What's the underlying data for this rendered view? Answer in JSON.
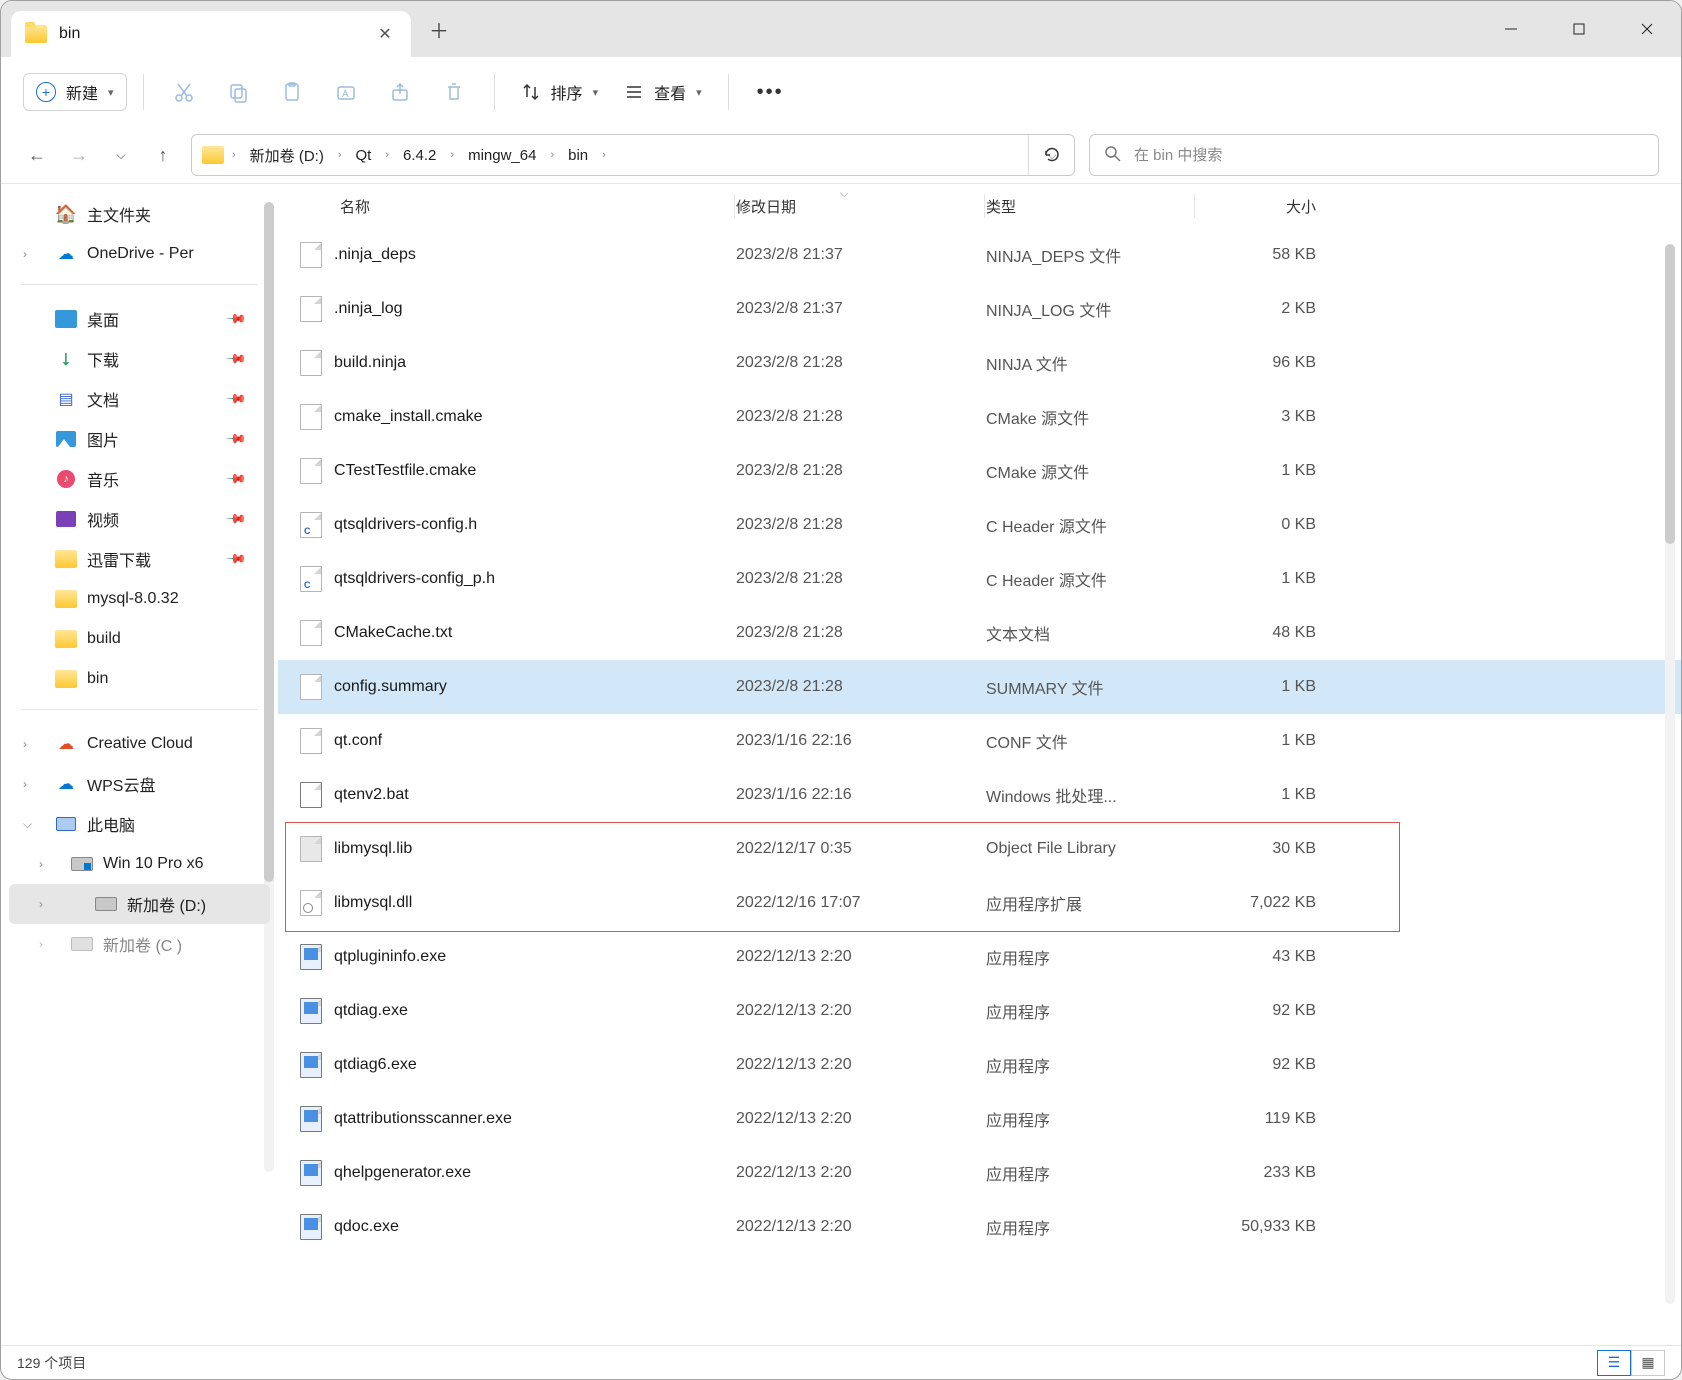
{
  "tab": {
    "title": "bin"
  },
  "toolbar": {
    "new_label": "新建",
    "sort_label": "排序",
    "view_label": "查看"
  },
  "navbar": {
    "search_placeholder": "在 bin 中搜索"
  },
  "breadcrumb": {
    "items": [
      "新加卷 (D:)",
      "Qt",
      "6.4.2",
      "mingw_64",
      "bin"
    ]
  },
  "columns": {
    "name": "名称",
    "date": "修改日期",
    "type": "类型",
    "size": "大小"
  },
  "sidebar": {
    "home": "主文件夹",
    "onedrive": "OneDrive - Per",
    "quick": {
      "desktop": "桌面",
      "downloads": "下载",
      "documents": "文档",
      "pictures": "图片",
      "music": "音乐",
      "videos": "视频",
      "xunlei": "迅雷下载",
      "mysql": "mysql-8.0.32",
      "build": "build",
      "bin": "bin"
    },
    "cc": "Creative Cloud",
    "wps": "WPS云盘",
    "thispc": "此电脑",
    "drive_c": "Win 10 Pro x6",
    "drive_d": "新加卷 (D:)",
    "drive_extra": "新加卷 (C )"
  },
  "files": [
    {
      "name": ".ninja_deps",
      "date": "2023/2/8 21:37",
      "type": "NINJA_DEPS 文件",
      "size": "58 KB",
      "ic": "plain"
    },
    {
      "name": ".ninja_log",
      "date": "2023/2/8 21:37",
      "type": "NINJA_LOG 文件",
      "size": "2 KB",
      "ic": "plain"
    },
    {
      "name": "build.ninja",
      "date": "2023/2/8 21:28",
      "type": "NINJA 文件",
      "size": "96 KB",
      "ic": "plain"
    },
    {
      "name": "cmake_install.cmake",
      "date": "2023/2/8 21:28",
      "type": "CMake 源文件",
      "size": "3 KB",
      "ic": "plain"
    },
    {
      "name": "CTestTestfile.cmake",
      "date": "2023/2/8 21:28",
      "type": "CMake 源文件",
      "size": "1 KB",
      "ic": "plain"
    },
    {
      "name": "qtsqldrivers-config.h",
      "date": "2023/2/8 21:28",
      "type": "C Header 源文件",
      "size": "0 KB",
      "ic": "c"
    },
    {
      "name": "qtsqldrivers-config_p.h",
      "date": "2023/2/8 21:28",
      "type": "C Header 源文件",
      "size": "1 KB",
      "ic": "c"
    },
    {
      "name": "CMakeCache.txt",
      "date": "2023/2/8 21:28",
      "type": "文本文档",
      "size": "48 KB",
      "ic": "plain"
    },
    {
      "name": "config.summary",
      "date": "2023/2/8 21:28",
      "type": "SUMMARY 文件",
      "size": "1 KB",
      "ic": "plain",
      "selected": true
    },
    {
      "name": "qt.conf",
      "date": "2023/1/16 22:16",
      "type": "CONF 文件",
      "size": "1 KB",
      "ic": "plain"
    },
    {
      "name": "qtenv2.bat",
      "date": "2023/1/16 22:16",
      "type": "Windows 批处理...",
      "size": "1 KB",
      "ic": "bat"
    },
    {
      "name": "libmysql.lib",
      "date": "2022/12/17 0:35",
      "type": "Object File Library",
      "size": "30 KB",
      "ic": "lib"
    },
    {
      "name": "libmysql.dll",
      "date": "2022/12/16 17:07",
      "type": "应用程序扩展",
      "size": "7,022 KB",
      "ic": "dll"
    },
    {
      "name": "qtplugininfo.exe",
      "date": "2022/12/13 2:20",
      "type": "应用程序",
      "size": "43 KB",
      "ic": "exe"
    },
    {
      "name": "qtdiag.exe",
      "date": "2022/12/13 2:20",
      "type": "应用程序",
      "size": "92 KB",
      "ic": "exe"
    },
    {
      "name": "qtdiag6.exe",
      "date": "2022/12/13 2:20",
      "type": "应用程序",
      "size": "92 KB",
      "ic": "exe"
    },
    {
      "name": "qtattributionsscanner.exe",
      "date": "2022/12/13 2:20",
      "type": "应用程序",
      "size": "119 KB",
      "ic": "exe"
    },
    {
      "name": "qhelpgenerator.exe",
      "date": "2022/12/13 2:20",
      "type": "应用程序",
      "size": "233 KB",
      "ic": "exe"
    },
    {
      "name": "qdoc.exe",
      "date": "2022/12/13 2:20",
      "type": "应用程序",
      "size": "50,933 KB",
      "ic": "exe"
    }
  ],
  "statusbar": {
    "count": "129 个项目"
  }
}
